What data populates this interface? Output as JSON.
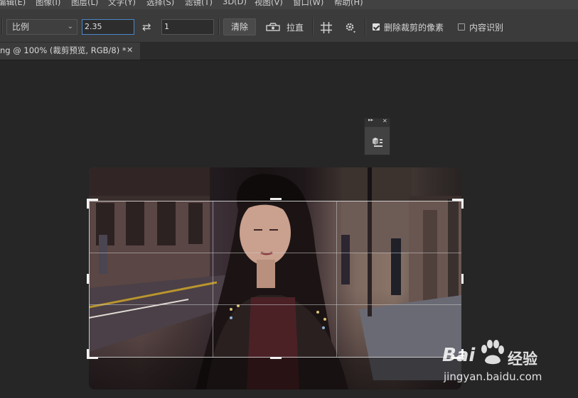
{
  "menubar": {
    "items": [
      "编辑(E)",
      "图像(I)",
      "图层(L)",
      "文字(Y)",
      "选择(S)",
      "滤镜(T)",
      "3D(D)",
      "视图(V)",
      "窗口(W)",
      "帮助(H)"
    ]
  },
  "options": {
    "ratio_select": "比例",
    "width_value": "2.35",
    "height_value": "1",
    "clear_label": "清除",
    "straighten_label": "拉直",
    "delete_cropped_label": "删除裁剪的像素",
    "delete_cropped_checked": true,
    "content_aware_label": "内容识别",
    "content_aware_checked": false
  },
  "document": {
    "tab_title": "ng @ 100% (裁剪预览, RGB/8) *"
  },
  "icons": {
    "chevron": "⌄",
    "swap": "⇄",
    "close": "✕",
    "collapse": "▸▸"
  },
  "watermark": {
    "brand_left": "Bai",
    "brand_right": "经验",
    "url": "jingyan.baidu.com"
  }
}
